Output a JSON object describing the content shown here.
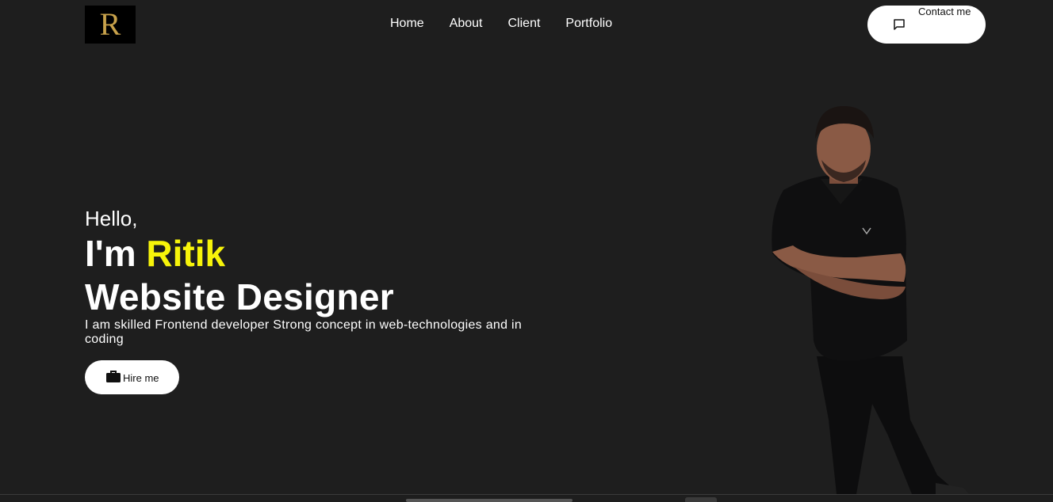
{
  "header": {
    "logo_letter": "R",
    "nav": [
      "Home",
      "About",
      "Client",
      "Portfolio"
    ],
    "contact_label": "Contact me",
    "contact_icon": "chat-icon"
  },
  "hero": {
    "greeting": "Hello,",
    "im_prefix": "I'm",
    "name": "Ritik",
    "role": "Website Designer",
    "description": "I am skilled Frontend developer Strong concept in web-technologies and in coding",
    "hire_label": "Hire me",
    "hire_icon": "briefcase-icon"
  },
  "colors": {
    "background": "#1e1e1e",
    "accent": "#f7f40a",
    "logo_gold": "#c8a24b",
    "button_bg": "#ffffff"
  }
}
